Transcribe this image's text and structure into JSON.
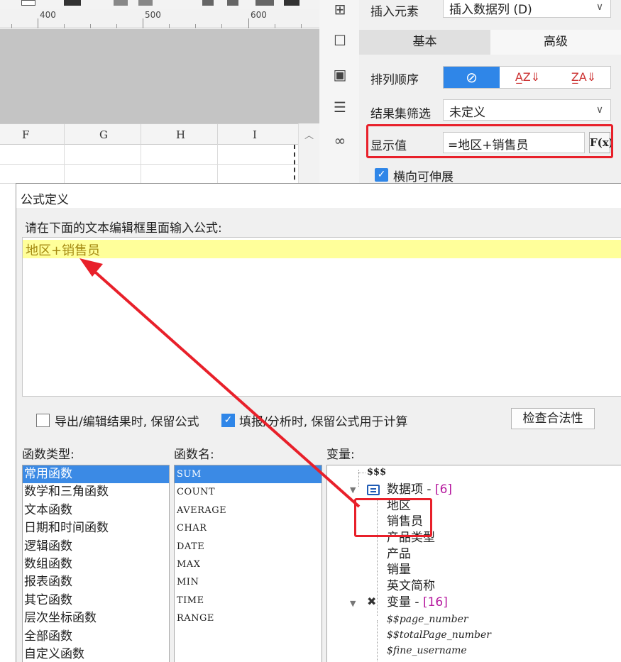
{
  "ruler": {
    "marks": [
      "400",
      "500",
      "600"
    ]
  },
  "columns": [
    "F",
    "G",
    "H",
    "I"
  ],
  "props": {
    "insert_element_label": "插入元素",
    "insert_element_value": "插入数据列 (D)",
    "tab_basic": "基本",
    "tab_advanced": "高级",
    "sort_label": "排列顺序",
    "filter_label": "结果集筛选",
    "filter_value": "未定义",
    "display_label": "显示值",
    "display_value": "=地区+销售员",
    "fx_label": "F(x)",
    "expand_label": "横向可伸展"
  },
  "dialog": {
    "title": "公式定义",
    "prompt": "请在下面的文本编辑框里面输入公式:",
    "formula": "地区+销售员",
    "keep_formula_export": "导出/编辑结果时, 保留公式",
    "keep_formula_fill": "填报/分析时, 保留公式用于计算",
    "check_validity": "检查合法性",
    "function_types_label": "函数类型:",
    "function_names_label": "函数名:",
    "variables_label": "变量:",
    "function_types": [
      "常用函数",
      "数学和三角函数",
      "文本函数",
      "日期和时间函数",
      "逻辑函数",
      "数组函数",
      "报表函数",
      "其它函数",
      "层次坐标函数",
      "全部函数",
      "自定义函数"
    ],
    "function_names": [
      "SUM",
      "COUNT",
      "AVERAGE",
      "CHAR",
      "DATE",
      "MAX",
      "MIN",
      "TIME",
      "RANGE"
    ],
    "variables": {
      "root": "$$$",
      "data_items_label": "数据项 - ",
      "data_items_count": "[6]",
      "data_items": [
        "地区",
        "销售员",
        "产品类型",
        "产品",
        "销量",
        "英文简称"
      ],
      "vars_label": "变量 - ",
      "vars_count": "[16]",
      "vars": [
        "$$page_number",
        "$$totalPage_number",
        "$fine_username"
      ]
    }
  },
  "colors": {
    "accent": "#2f86e8",
    "highlight_red": "#e8202a",
    "formula_bg": "#ffff9a"
  }
}
